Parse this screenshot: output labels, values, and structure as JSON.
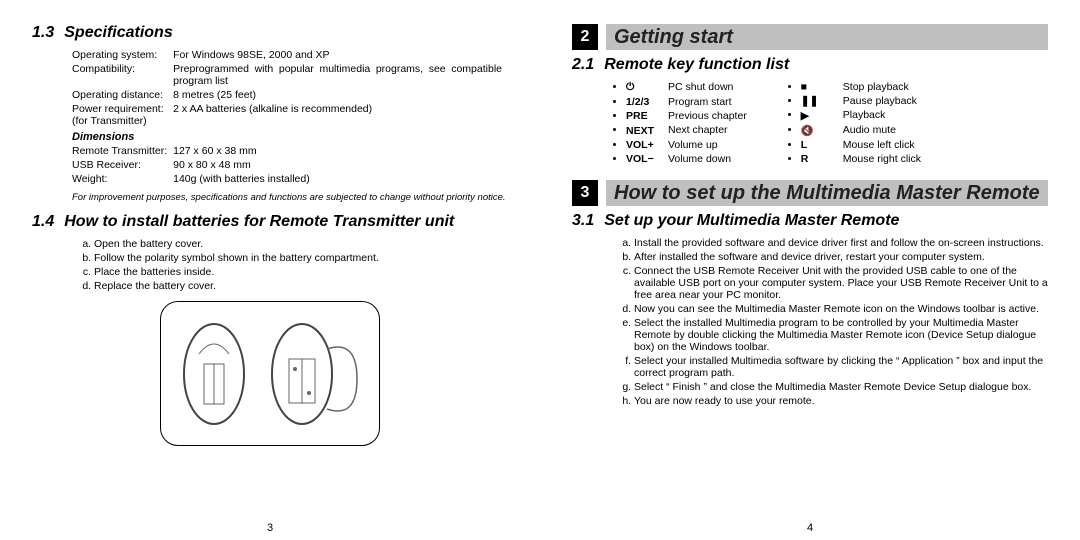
{
  "left": {
    "sec13_num": "1.3",
    "sec13_title": "Specifications",
    "spec": {
      "os_l": "Operating system:",
      "os_v": "For Windows 98SE, 2000 and XP",
      "comp_l": "Compatibility:",
      "comp_v": "Preprogrammed with popular multimedia programs, see compatible program list",
      "dist_l": "Operating distance:",
      "dist_v": "8 metres (25 feet)",
      "pow_l": "Power requirement:\n(for Transmitter)",
      "pow_v": "2 x AA batteries (alkaline is recommended)",
      "dims_h": "Dimensions",
      "rt_l": "Remote Transmitter:",
      "rt_v": "127 x 60 x 38 mm",
      "usb_l": "USB Receiver:",
      "usb_v": "90 x 80 x 48 mm",
      "wt_l": "Weight:",
      "wt_v": "140g (with batteries installed)"
    },
    "footnote": "For improvement purposes, specifications and functions are subjected to change without priority notice.",
    "sec14_num": "1.4",
    "sec14_title": "How to install batteries for Remote Transmitter unit",
    "steps14": [
      "Open the battery cover.",
      "Follow the polarity symbol shown in the battery compartment.",
      "Place the batteries inside.",
      "Replace the battery cover."
    ],
    "page_num": "3"
  },
  "right": {
    "h2_num": "2",
    "h2_title": "Getting start",
    "sec21_num": "2.1",
    "sec21_title": "Remote key function list",
    "keys_left": [
      {
        "sym": "⏻",
        "desc": "PC shut down"
      },
      {
        "sym": "1/2/3",
        "desc": "Program start"
      },
      {
        "sym": "PRE",
        "desc": "Previous chapter"
      },
      {
        "sym": "NEXT",
        "desc": "Next chapter"
      },
      {
        "sym": "VOL+",
        "desc": "Volume up"
      },
      {
        "sym": "VOL−",
        "desc": "Volume down"
      }
    ],
    "keys_right": [
      {
        "sym": "■",
        "desc": "Stop playback"
      },
      {
        "sym": "❚❚",
        "desc": "Pause playback"
      },
      {
        "sym": "▶",
        "desc": "Playback"
      },
      {
        "sym": "🔇",
        "desc": "Audio mute"
      },
      {
        "sym": "L",
        "desc": "Mouse left click"
      },
      {
        "sym": "R",
        "desc": "Mouse right click"
      }
    ],
    "h3_num": "3",
    "h3_title": "How to set up the Multimedia Master Remote",
    "sec31_num": "3.1",
    "sec31_title": "Set up your Multimedia Master Remote",
    "steps31": [
      "Install the provided software and device driver first and follow the on-screen instructions.",
      "After installed the software and device driver, restart your computer system.",
      "Connect the USB Remote Receiver Unit with the provided USB cable to one of the available USB port on your computer system. Place your USB Remote Receiver Unit to a free area near your PC monitor.",
      "Now you can see the Multimedia Master Remote icon on the Windows toolbar is active.",
      "Select the installed Multimedia program to be controlled by your Multimedia Master Remote by double clicking the Multimedia Master Remote icon (Device Setup dialogue box) on the Windows toolbar.",
      "Select your installed Multimedia software by clicking the “ Application ” box and input the correct program path.",
      "Select “ Finish ” and close the Multimedia Master Remote Device Setup dialogue box.",
      "You are now ready to use your remote."
    ],
    "page_num": "4"
  }
}
